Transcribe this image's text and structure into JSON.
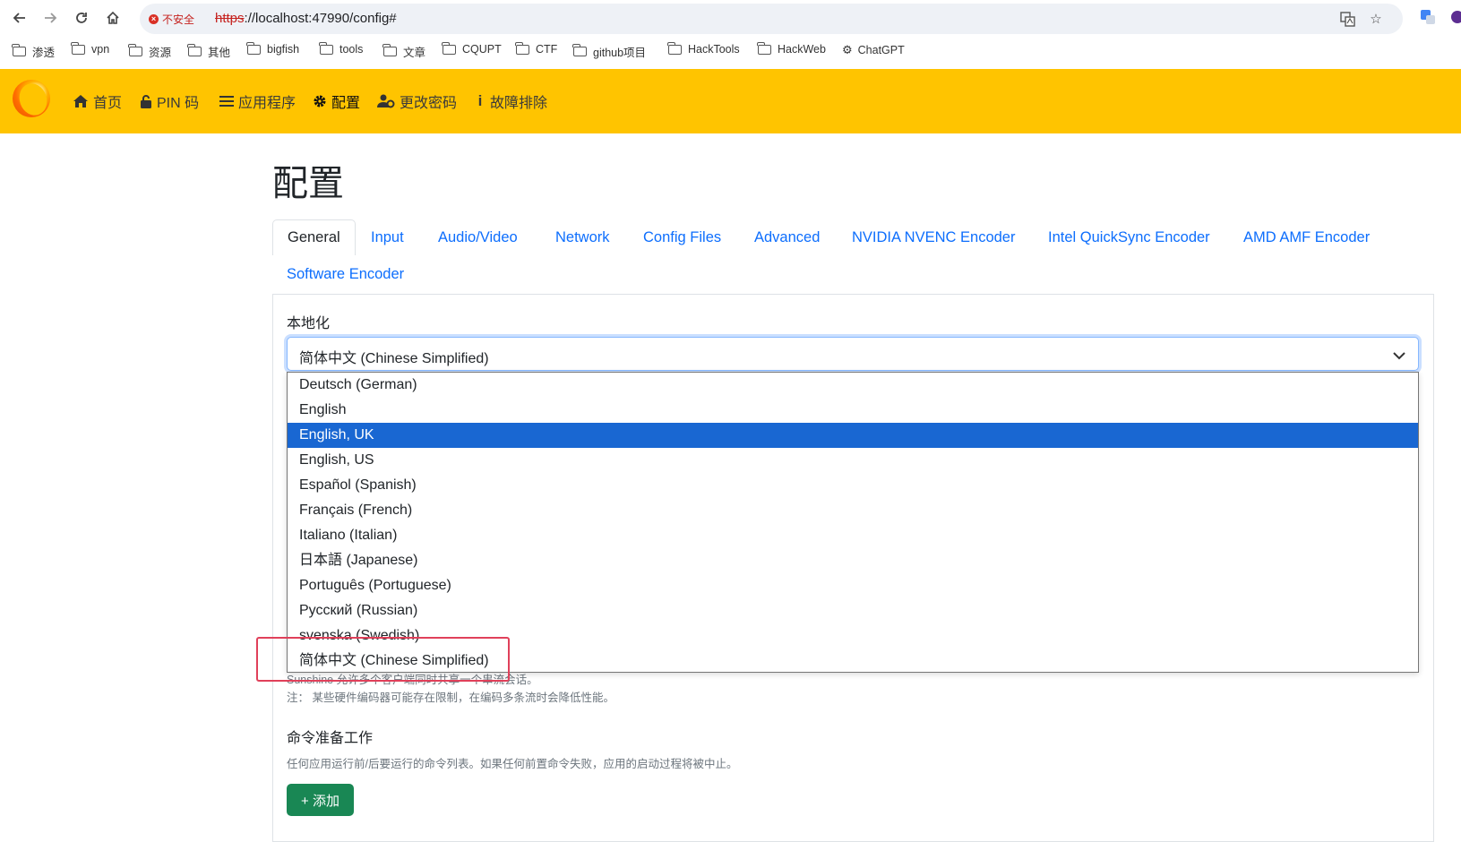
{
  "browser": {
    "security_label": "不安全",
    "url_scheme": "https",
    "url_rest": "://localhost:47990/config#",
    "bookmarks": [
      "渗透",
      "vpn",
      "资源",
      "其他",
      "bigfish",
      "tools",
      "文章",
      "CQUPT",
      "CTF",
      "github项目",
      "HackTools",
      "HackWeb",
      "ChatGPT"
    ]
  },
  "navbar": {
    "items": [
      {
        "label": "首页",
        "icon": "home-icon"
      },
      {
        "label": "PIN 码",
        "icon": "lock-icon"
      },
      {
        "label": "应用程序",
        "icon": "list-icon"
      },
      {
        "label": "配置",
        "icon": "gear-icon"
      },
      {
        "label": "更改密码",
        "icon": "user-cog-icon"
      },
      {
        "label": "故障排除",
        "icon": "info-icon"
      }
    ]
  },
  "page": {
    "title": "配置",
    "tabs": [
      "General",
      "Input",
      "Audio/Video",
      "Network",
      "Config Files",
      "Advanced",
      "NVIDIA NVENC Encoder",
      "Intel QuickSync Encoder",
      "AMD AMF Encoder",
      "Software Encoder"
    ],
    "active_tab": "General"
  },
  "locale": {
    "label": "本地化",
    "selected": "简体中文 (Chinese Simplified)",
    "options": [
      "Deutsch (German)",
      "English",
      "English, UK",
      "English, US",
      "Español (Spanish)",
      "Français (French)",
      "Italiano (Italian)",
      "日本語 (Japanese)",
      "Português (Portuguese)",
      "Русский (Russian)",
      "svenska (Swedish)",
      "简体中文 (Chinese Simplified)"
    ],
    "hovered": "English, UK"
  },
  "help": {
    "line1": "Sunshine 允许多个客户端同时共享一个串流会话。",
    "line2": "注： 某些硬件编码器可能存在限制，在编码多条流时会降低性能。"
  },
  "commands": {
    "title": "命令准备工作",
    "description": "任何应用运行前/后要运行的命令列表。如果任何前置命令失败，应用的启动过程将被中止。",
    "add_label": "+ 添加"
  },
  "colors": {
    "navbar": "#ffc400",
    "link": "#0d6efd",
    "selected_option": "#1967d2",
    "add_button": "#198754",
    "highlight": "#e0405a"
  }
}
